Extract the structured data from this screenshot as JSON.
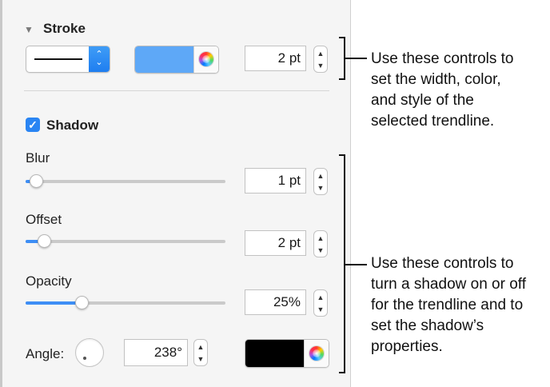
{
  "stroke": {
    "title": "Stroke",
    "disclosure_icon": "disclosure-triangle-icon",
    "style_popup": {
      "selected": "solid-line"
    },
    "color": "#5ea8f7",
    "width_value": "2 pt"
  },
  "shadow": {
    "checkbox_label": "Shadow",
    "checked": true,
    "blur": {
      "label": "Blur",
      "level": 0.02,
      "value": "1 pt"
    },
    "offset": {
      "label": "Offset",
      "level": 0.06,
      "value": "2 pt"
    },
    "opacity": {
      "label": "Opacity",
      "level": 0.25,
      "value": "25%"
    },
    "angle": {
      "label": "Angle:",
      "value": "238°",
      "degrees": 238
    },
    "color": "#000000"
  },
  "callouts": {
    "stroke": "Use these controls to\nset the width, color,\nand style of the\nselected trendline.",
    "shadow": "Use these controls to\nturn a shadow on or off\nfor the trendline and to\nset the shadow’s\nproperties."
  },
  "accent_color": "#2a85f3"
}
